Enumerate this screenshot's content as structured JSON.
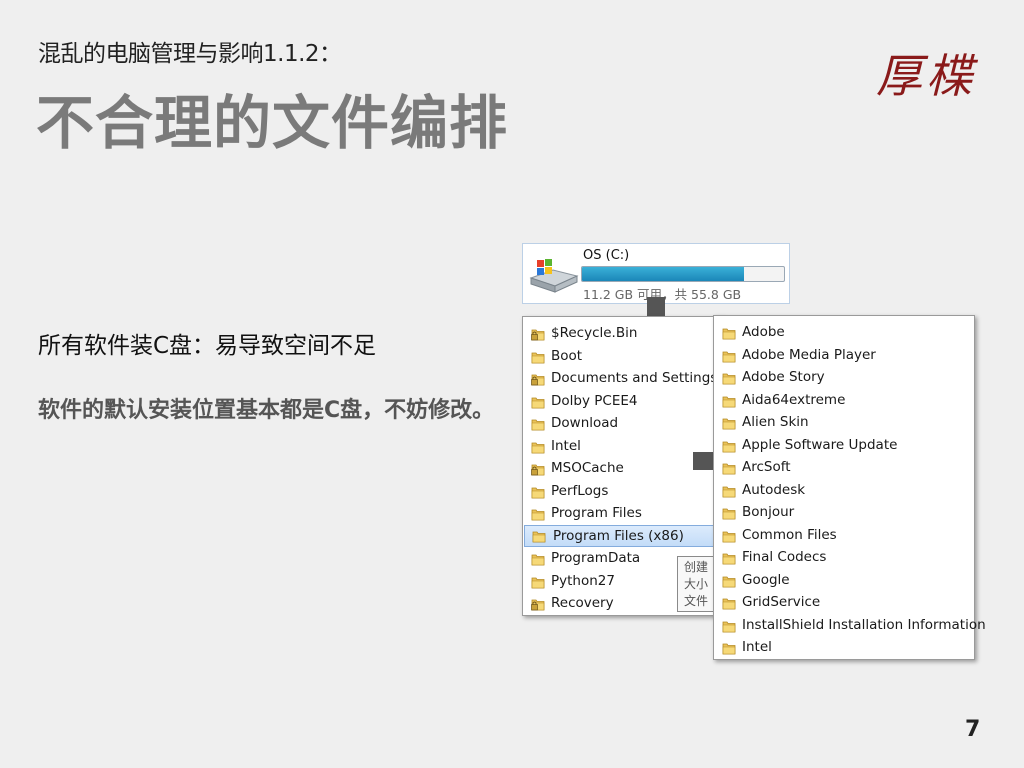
{
  "slide": {
    "subtitle": "混乱的电脑管理与影响1.1.2：",
    "title": "不合理的文件编排",
    "logo": "厚楪",
    "point1": "所有软件装C盘：易导致空间不足",
    "point2": "软件的默认安装位置基本都是C盘，不妨修改。",
    "page_number": "7"
  },
  "drive": {
    "name": "OS (C:)",
    "info": "11.2 GB 可用，共 55.8 GB",
    "used_fraction": 0.8,
    "icon": "hard-drive-windows-icon"
  },
  "left_list": {
    "items": [
      {
        "label": "$Recycle.Bin",
        "icon": "locked-folder-icon"
      },
      {
        "label": "Boot",
        "icon": "folder-icon"
      },
      {
        "label": "Documents and Settings",
        "icon": "locked-folder-icon"
      },
      {
        "label": "Dolby PCEE4",
        "icon": "folder-icon"
      },
      {
        "label": "Download",
        "icon": "folder-icon"
      },
      {
        "label": "Intel",
        "icon": "folder-icon"
      },
      {
        "label": "MSOCache",
        "icon": "locked-folder-icon"
      },
      {
        "label": "PerfLogs",
        "icon": "folder-icon"
      },
      {
        "label": "Program Files",
        "icon": "folder-icon"
      },
      {
        "label": "Program Files (x86)",
        "icon": "folder-icon",
        "selected": true
      },
      {
        "label": "ProgramData",
        "icon": "folder-icon"
      },
      {
        "label": "Python27",
        "icon": "folder-icon"
      },
      {
        "label": "Recovery",
        "icon": "locked-folder-icon"
      }
    ]
  },
  "tooltip": {
    "line1": "创建",
    "line2": "大小",
    "line3": "文件"
  },
  "right_list": {
    "items": [
      {
        "label": "Adobe"
      },
      {
        "label": "Adobe Media Player"
      },
      {
        "label": "Adobe Story"
      },
      {
        "label": "Aida64extreme"
      },
      {
        "label": "Alien Skin"
      },
      {
        "label": "Apple Software Update"
      },
      {
        "label": "ArcSoft"
      },
      {
        "label": "Autodesk"
      },
      {
        "label": "Bonjour"
      },
      {
        "label": "Common Files"
      },
      {
        "label": "Final Codecs"
      },
      {
        "label": "Google"
      },
      {
        "label": "GridService"
      },
      {
        "label": "InstallShield Installation Information"
      },
      {
        "label": "Intel"
      }
    ]
  },
  "colors": {
    "title": "#7a7a7a",
    "logo": "#8a1a1a",
    "arrow": "#555555",
    "selection": "#c3dcf8",
    "drive_fill": "#1b86b8"
  }
}
